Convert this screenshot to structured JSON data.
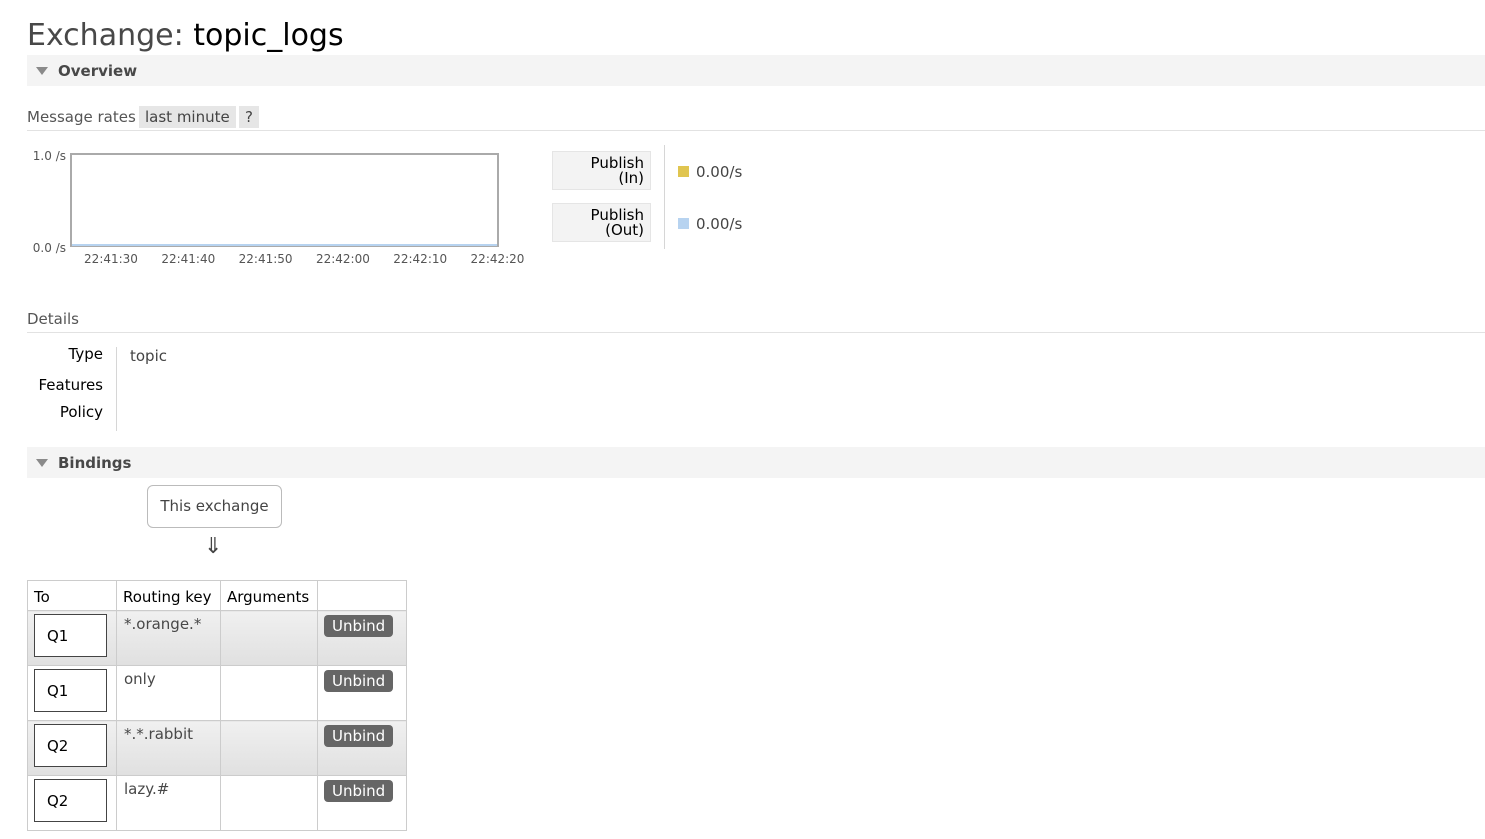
{
  "page": {
    "title_prefix": "Exchange:",
    "exchange_name": "topic_logs"
  },
  "sections": {
    "overview": "Overview",
    "bindings": "Bindings"
  },
  "message_rates": {
    "label": "Message rates",
    "range": "last minute",
    "help": "?"
  },
  "chart_data": {
    "type": "line",
    "x": [
      "22:41:30",
      "22:41:40",
      "22:41:50",
      "22:42:00",
      "22:42:10",
      "22:42:20"
    ],
    "y_ticks": [
      "1.0 /s",
      "0.0 /s"
    ],
    "ylim": [
      0,
      1
    ],
    "series": [
      {
        "name": "Publish (In)",
        "color": "#e0c550",
        "values": [
          0,
          0,
          0,
          0,
          0,
          0
        ]
      },
      {
        "name": "Publish (Out)",
        "color": "#b7d3f0",
        "values": [
          0,
          0,
          0,
          0,
          0,
          0
        ]
      }
    ]
  },
  "legend": [
    {
      "line1": "Publish",
      "line2": "(In)",
      "value": "0.00/s",
      "color": "#e0c550"
    },
    {
      "line1": "Publish",
      "line2": "(Out)",
      "value": "0.00/s",
      "color": "#b7d3f0"
    }
  ],
  "details": {
    "heading": "Details",
    "type_label": "Type",
    "type_value": "topic",
    "features_label": "Features",
    "features_value": "",
    "policy_label": "Policy",
    "policy_value": ""
  },
  "bindings": {
    "source": "This exchange",
    "arrow": "⇓",
    "columns": [
      "To",
      "Routing key",
      "Arguments",
      ""
    ],
    "unbind_label": "Unbind",
    "rows": [
      {
        "to": "Q1",
        "routing_key": "*.orange.*",
        "arguments": ""
      },
      {
        "to": "Q1",
        "routing_key": "only",
        "arguments": ""
      },
      {
        "to": "Q2",
        "routing_key": "*.*.rabbit",
        "arguments": ""
      },
      {
        "to": "Q2",
        "routing_key": "lazy.#",
        "arguments": ""
      }
    ]
  }
}
